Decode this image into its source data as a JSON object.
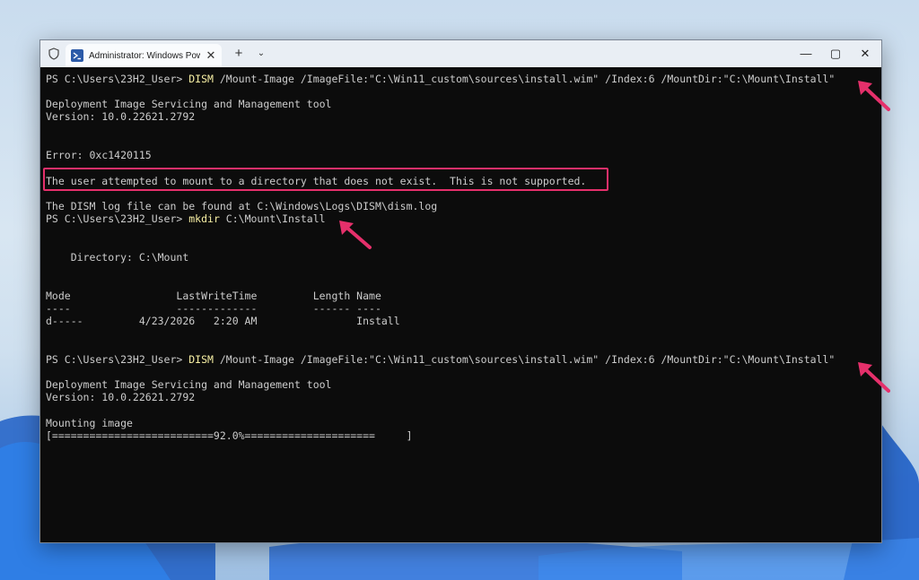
{
  "window": {
    "tab_title": "Administrator: Windows PowerShell",
    "tab_close": "✕",
    "new_tab": "+",
    "dropdown": "⌄",
    "minimize": "—",
    "maximize": "▢",
    "close": "✕"
  },
  "terminal": {
    "l1_prompt": "PS C:\\Users\\23H2_User> ",
    "l1_cmd": "DISM",
    "l1_args": " /Mount-Image /ImageFile:\"C:\\Win11_custom\\sources\\install.wim\" /Index:6 /MountDir:\"C:\\Mount\\Install\"",
    "l2": "Deployment Image Servicing and Management tool",
    "l3": "Version: 10.0.22621.2792",
    "l4": "Error: 0xc1420115",
    "l5": "The user attempted to mount to a directory that does not exist.  This is not supported.",
    "l6": "The DISM log file can be found at C:\\Windows\\Logs\\DISM\\dism.log",
    "l7_prompt": "PS C:\\Users\\23H2_User> ",
    "l7_cmd": "mkdir",
    "l7_args": " C:\\Mount\\Install",
    "l8": "    Directory: C:\\Mount",
    "l9": "Mode                 LastWriteTime         Length Name",
    "l10": "----                 -------------         ------ ----",
    "l11": "d-----         4/23/2026   2:20 AM                Install",
    "l12_prompt": "PS C:\\Users\\23H2_User> ",
    "l12_cmd": "DISM",
    "l12_args": " /Mount-Image /ImageFile:\"C:\\Win11_custom\\sources\\install.wim\" /Index:6 /MountDir:\"C:\\Mount\\Install\"",
    "l13": "Deployment Image Servicing and Management tool",
    "l14": "Version: 10.0.22621.2792",
    "l15": "Mounting image",
    "l16": "[==========================92.0%=====================     ]"
  },
  "colors": {
    "accent_annotation": "#e5306b",
    "command_yellow": "#f9f1a5",
    "terminal_bg": "#0c0c0c",
    "terminal_text": "#cccccc"
  }
}
